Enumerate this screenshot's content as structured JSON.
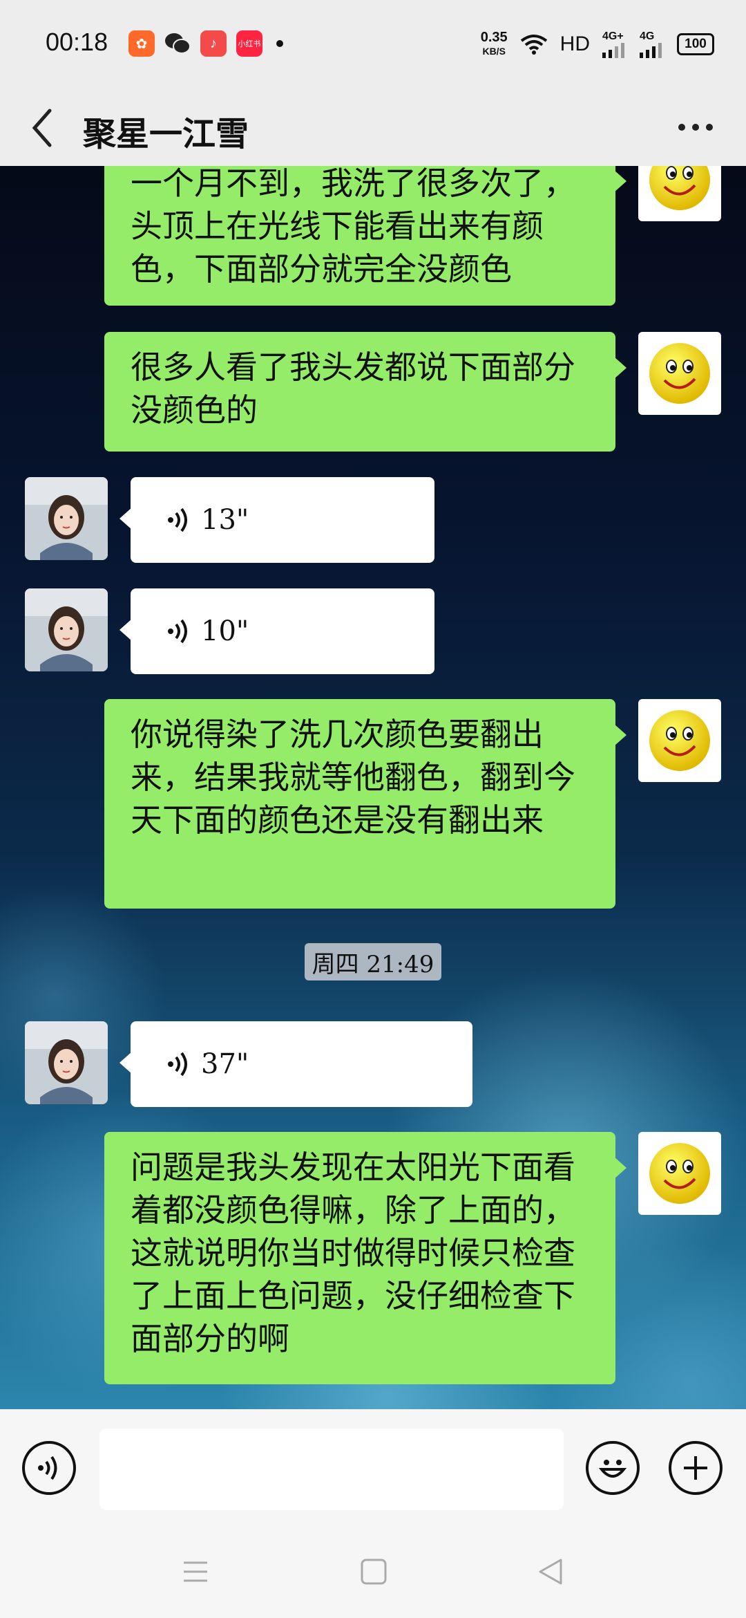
{
  "status_bar": {
    "time": "00:18",
    "net_speed_value": "0.35",
    "net_speed_unit": "KB/S",
    "hd": "HD",
    "signal1": "4G+",
    "signal2": "4G",
    "battery": "100",
    "apps": [
      {
        "name": "kuaishou-icon",
        "color": "#ff6a2a",
        "glyph": "✿"
      },
      {
        "name": "wechat-icon",
        "color": "#2c2c2c",
        "glyph": "●"
      },
      {
        "name": "music-icon",
        "color": "#f34a4a",
        "glyph": "♪"
      },
      {
        "name": "xiaohongshu-icon",
        "color": "#ff2442",
        "glyph": "小红书"
      }
    ]
  },
  "header": {
    "title": "聚星一江雪"
  },
  "messages": [
    {
      "type": "me",
      "text": "一个月不到，我洗了很多次了，头顶上在光线下能看出来有颜色，下面部分就完全没颜色"
    },
    {
      "type": "me",
      "text": "很多人看了我头发都说下面部分没颜色的"
    },
    {
      "type": "them_voice",
      "duration": "13\""
    },
    {
      "type": "them_voice",
      "duration": "10\""
    },
    {
      "type": "me",
      "text": "你说得染了洗几次颜色要翻出来，结果我就等他翻色，翻到今天下面的颜色还是没有翻出来"
    },
    {
      "type": "timestamp",
      "text": "周四 21:49"
    },
    {
      "type": "them_voice",
      "duration": "37\""
    },
    {
      "type": "me",
      "text": "问题是我头发现在太阳光下面看着都没颜色得嘛，除了上面的，这就说明你当时做得时候只检查了上面上色问题，没仔细检查下面部分的啊"
    }
  ],
  "colors": {
    "my_bubble": "#95ec69",
    "their_bubble": "#ffffff",
    "chrome": "#ededed"
  }
}
